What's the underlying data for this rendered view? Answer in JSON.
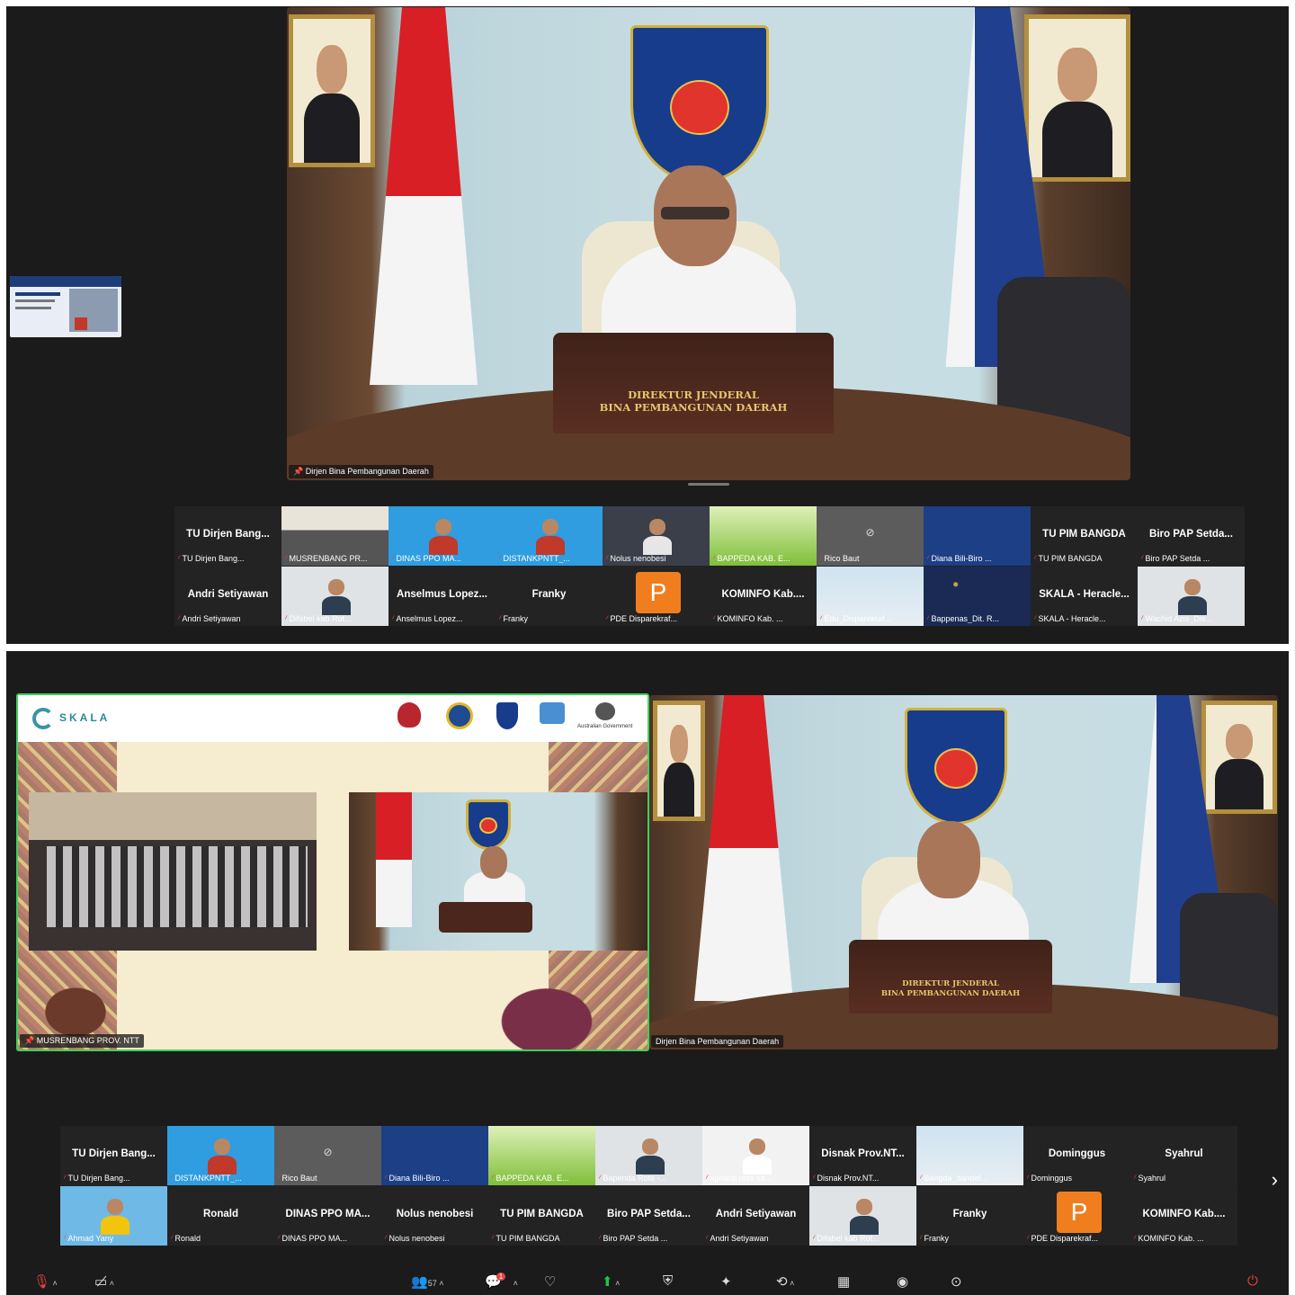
{
  "screen1": {
    "speaker_name": "Dirjen Bina Pembangunan Daerah",
    "desk_plaque": [
      "DIREKTUR JENDERAL",
      "BINA PEMBANGUNAN DAERAH"
    ],
    "row1": [
      {
        "title": "TU Dirjen Bang...",
        "label": "TU Dirjen Bang...",
        "kind": "name"
      },
      {
        "title": "",
        "label": "MUSRENBANG PR...",
        "kind": "meeting"
      },
      {
        "title": "",
        "label": "DINAS PPO MA...",
        "kind": "person-blue"
      },
      {
        "title": "",
        "label": "DISTANKPNTT_...",
        "kind": "person-blue"
      },
      {
        "title": "",
        "label": "Nolus nenobesi",
        "kind": "person-dark"
      },
      {
        "title": "",
        "label": "BAPPEDA KAB. E...",
        "kind": "grass"
      },
      {
        "title": "",
        "label": "Rico Baut",
        "kind": "camoff"
      },
      {
        "title": "",
        "label": "Diana Bili-Biro ...",
        "kind": "poster"
      },
      {
        "title": "TU PIM BANGDA",
        "label": "TU PIM BANGDA",
        "kind": "name"
      },
      {
        "title": "Biro PAP Setda...",
        "label": "Biro PAP Setda ...",
        "kind": "name"
      }
    ],
    "row2": [
      {
        "title": "Andri Setiyawan",
        "label": "Andri Setiyawan",
        "kind": "name"
      },
      {
        "title": "",
        "label": "Difabel kab Rot...",
        "kind": "person-light"
      },
      {
        "title": "Anselmus Lopez...",
        "label": "Anselmus Lopez...",
        "kind": "name"
      },
      {
        "title": "Franky",
        "label": "Franky",
        "kind": "name"
      },
      {
        "title": "P",
        "label": "PDE Disparekraf...",
        "kind": "letter"
      },
      {
        "title": "KOMINFO Kab....",
        "label": "KOMINFO Kab. ...",
        "kind": "name"
      },
      {
        "title": "",
        "label": "Edu_Disparekraf...",
        "kind": "sky"
      },
      {
        "title": "",
        "label": "Bappenas_Dit. R...",
        "kind": "stars"
      },
      {
        "title": "SKALA - Heracle...",
        "label": "SKALA - Heracle...",
        "kind": "name"
      },
      {
        "title": "",
        "label": "Wachid Azis_Dis...",
        "kind": "person-light"
      }
    ]
  },
  "screen2": {
    "left_name": "MUSRENBANG PROV. NTT",
    "right_name": "Dirjen Bina Pembangunan Daerah",
    "brand": "SKALA",
    "gov_label": "Australian Government",
    "desk_plaque": [
      "DIREKTUR JENDERAL",
      "BINA PEMBANGUNAN DAERAH"
    ],
    "row1": [
      {
        "title": "TU Dirjen Bang...",
        "label": "TU Dirjen Bang...",
        "kind": "name"
      },
      {
        "title": "",
        "label": "DISTANKPNTT_...",
        "kind": "person-blue"
      },
      {
        "title": "",
        "label": "Rico Baut",
        "kind": "camoff"
      },
      {
        "title": "",
        "label": "Diana Bili-Biro ...",
        "kind": "poster"
      },
      {
        "title": "",
        "label": "BAPPEDA KAB. E...",
        "kind": "grass"
      },
      {
        "title": "",
        "label": "Bapenda Rote -...",
        "kind": "person-light"
      },
      {
        "title": "",
        "label": "aprianti resti sa...",
        "kind": "person-white"
      },
      {
        "title": "Disnak Prov.NT...",
        "label": "Disnak Prov.NT...",
        "kind": "name"
      },
      {
        "title": "",
        "label": "Bangda_dandel...",
        "kind": "sky"
      },
      {
        "title": "Dominggus",
        "label": "Dominggus",
        "kind": "name"
      },
      {
        "title": "Syahrul",
        "label": "Syahrul",
        "kind": "name"
      }
    ],
    "row2": [
      {
        "title": "",
        "label": "Ahmad Yany",
        "kind": "person-yellow"
      },
      {
        "title": "Ronald",
        "label": "Ronald",
        "kind": "name"
      },
      {
        "title": "DINAS PPO MA...",
        "label": "DINAS PPO MA...",
        "kind": "name"
      },
      {
        "title": "Nolus nenobesi",
        "label": "Nolus nenobesi",
        "kind": "name"
      },
      {
        "title": "TU PIM BANGDA",
        "label": "TU PIM BANGDA",
        "kind": "name"
      },
      {
        "title": "Biro PAP Setda...",
        "label": "Biro PAP Setda ...",
        "kind": "name"
      },
      {
        "title": "Andri Setiyawan",
        "label": "Andri Setiyawan",
        "kind": "name"
      },
      {
        "title": "",
        "label": "Difabel kab Rot...",
        "kind": "person-light"
      },
      {
        "title": "Franky",
        "label": "Franky",
        "kind": "name"
      },
      {
        "title": "P",
        "label": "PDE Disparekraf...",
        "kind": "letter"
      },
      {
        "title": "KOMINFO Kab....",
        "label": "KOMINFO Kab. ...",
        "kind": "name"
      }
    ]
  },
  "toolbar": {
    "participants_count": "57",
    "chat_badge": "1"
  },
  "colors": {
    "background": "#1b1b1b",
    "tile": "#232323",
    "mic_off": "#e0443e",
    "active_border": "#3fd15a",
    "letter_avatar": "#f07e1f",
    "share_green": "#22c24a"
  }
}
